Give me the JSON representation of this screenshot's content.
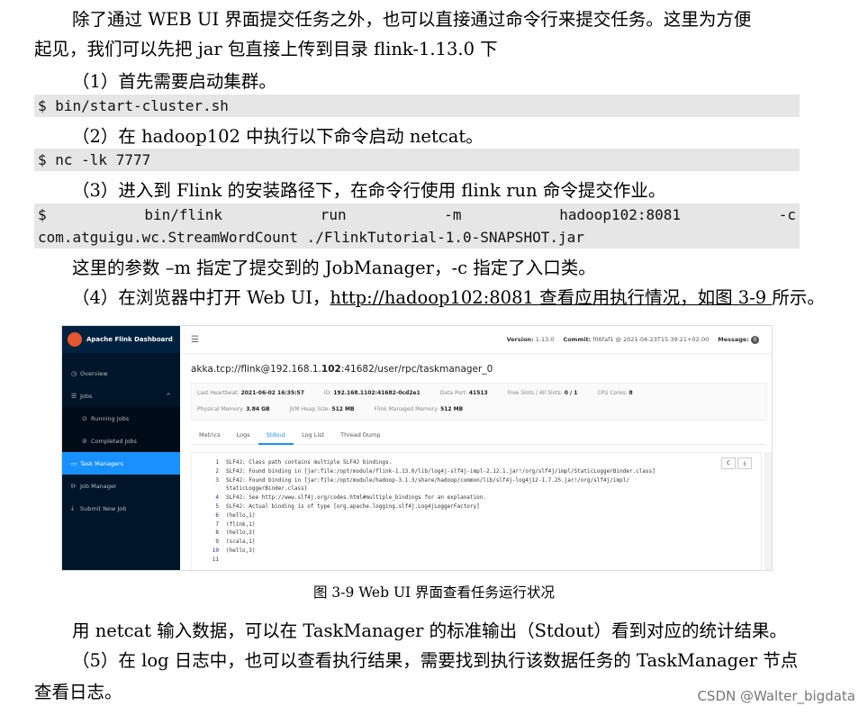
{
  "paragraphs": {
    "p1_line1": "除了通过 WEB UI 界面提交任务之外，也可以直接通过命令行来提交任务。这里为方便",
    "p1_line2": "起见，我们可以先把 jar 包直接上传到目录 flink-1.13.0 下",
    "step1": "（1）首先需要启动集群。",
    "step2": "（2）在 hadoop102 中执行以下命令启动 netcat。",
    "step3": "（3）进入到 Flink 的安装路径下，在命令行使用 flink run 命令提交作业。",
    "params": "这里的参数 –m 指定了提交到的 JobManager，-c 指定了入口类。",
    "step4_prefix": "（4）在浏览器中打开 Web UI，",
    "step4_link": "http://hadoop102:8081 查看应用执行情况，如图 3-9 ",
    "step4_suffix": "所示。",
    "after1": "用 netcat 输入数据，可以在 TaskManager 的标准输出（Stdout）看到对应的统计结果。",
    "after2_line1": "（5）在 log 日志中，也可以查看执行结果，需要找到执行该数据任务的 TaskManager 节点",
    "after2_line2": "查看日志。"
  },
  "code": {
    "start_cluster": "$ bin/start-cluster.sh",
    "netcat": "$ nc -lk 7777",
    "run_tokens": [
      "$",
      "bin/flink",
      "run",
      "-m",
      "hadoop102:8081",
      "-c"
    ],
    "run_line2": "com.atguigu.wc.StreamWordCount ./FlinkTutorial-1.0-SNAPSHOT.jar"
  },
  "figure": {
    "brand": "Apache Flink Dashboard",
    "nav": [
      {
        "icon": "◷",
        "label": "Overview"
      },
      {
        "icon": "☰",
        "label": "Jobs",
        "caret": "^"
      },
      {
        "icon": "⊙",
        "label": "Running Jobs"
      },
      {
        "icon": "⊘",
        "label": "Completed Jobs"
      },
      {
        "icon": "▭",
        "label": "Task Managers"
      },
      {
        "icon": "⊪",
        "label": "Job Manager"
      },
      {
        "icon": "⤓",
        "label": "Submit New Job"
      }
    ],
    "topbar": {
      "version_label": "Version:",
      "version": "1.13.0",
      "commit_label": "Commit:",
      "commit": "f06faf1 @ 2021-04-23T15:39:21+02:00",
      "message_label": "Message:",
      "message_count": "0"
    },
    "path_pre": "akka.tcp://flink@192.168.1.",
    "path_bold": "102",
    "path_post": ":41682/user/rpc/taskmanager_0",
    "info_row1": [
      {
        "label": "Last Heartbeat:",
        "value": "2021-06-02 16:35:57"
      },
      {
        "label": "ID:",
        "value": "192.168.1102:41682-0cd2e1"
      },
      {
        "label": "Data Port:",
        "value": "41513"
      },
      {
        "label": "Free Slots / All Slots:",
        "value": "0 / 1"
      },
      {
        "label": "CPU Cores:",
        "value": "8"
      }
    ],
    "info_row2": [
      {
        "label": "Physical Memory:",
        "value": "3.84 GB"
      },
      {
        "label": "JVM Heap Size:",
        "value": "512 MB"
      },
      {
        "label": "Flink Managed Memory:",
        "value": "512 MB"
      }
    ],
    "tabs": [
      "Metrics",
      "Logs",
      "Stdout",
      "Log List",
      "Thread Dump"
    ],
    "log_lines": [
      {
        "no": "1",
        "text": "SLF4J: Class path contains multiple SLF4J bindings."
      },
      {
        "no": "2",
        "text": "SLF4J: Found binding in [jar:file:/opt/module/flink-1.13.0/lib/log4j-slf4j-impl-2.12.1.jar!/org/slf4j/impl/StaticLoggerBinder.class]"
      },
      {
        "no": "3",
        "text": "SLF4J: Found binding in [jar:file:/opt/module/hadoop-3.1.3/share/hadoop/common/lib/slf4j-log4j12-1.7.25.jar!/org/slf4j/impl/"
      },
      {
        "no": "",
        "text": "StaticLoggerBinder.class]"
      },
      {
        "no": "4",
        "text": "SLF4J: See http://www.slf4j.org/codes.html#multiple_bindings for an explanation."
      },
      {
        "no": "5",
        "text": "SLF4J: Actual binding is of type [org.apache.logging.slf4j.Log4jLoggerFactory]"
      },
      {
        "no": "6",
        "text": "(hello,1)"
      },
      {
        "no": "7",
        "text": "(flink,1)"
      },
      {
        "no": "8",
        "text": "(hello,2)"
      },
      {
        "no": "9",
        "text": "(scala,1)"
      },
      {
        "no": "10",
        "text": "(hello,3)"
      },
      {
        "no": "11",
        "text": ""
      }
    ],
    "tool_icons": [
      "C",
      "⤓"
    ]
  },
  "caption": "图 3-9 Web UI 界面查看任务运行状况",
  "watermark": "CSDN @Walter_bigdata"
}
